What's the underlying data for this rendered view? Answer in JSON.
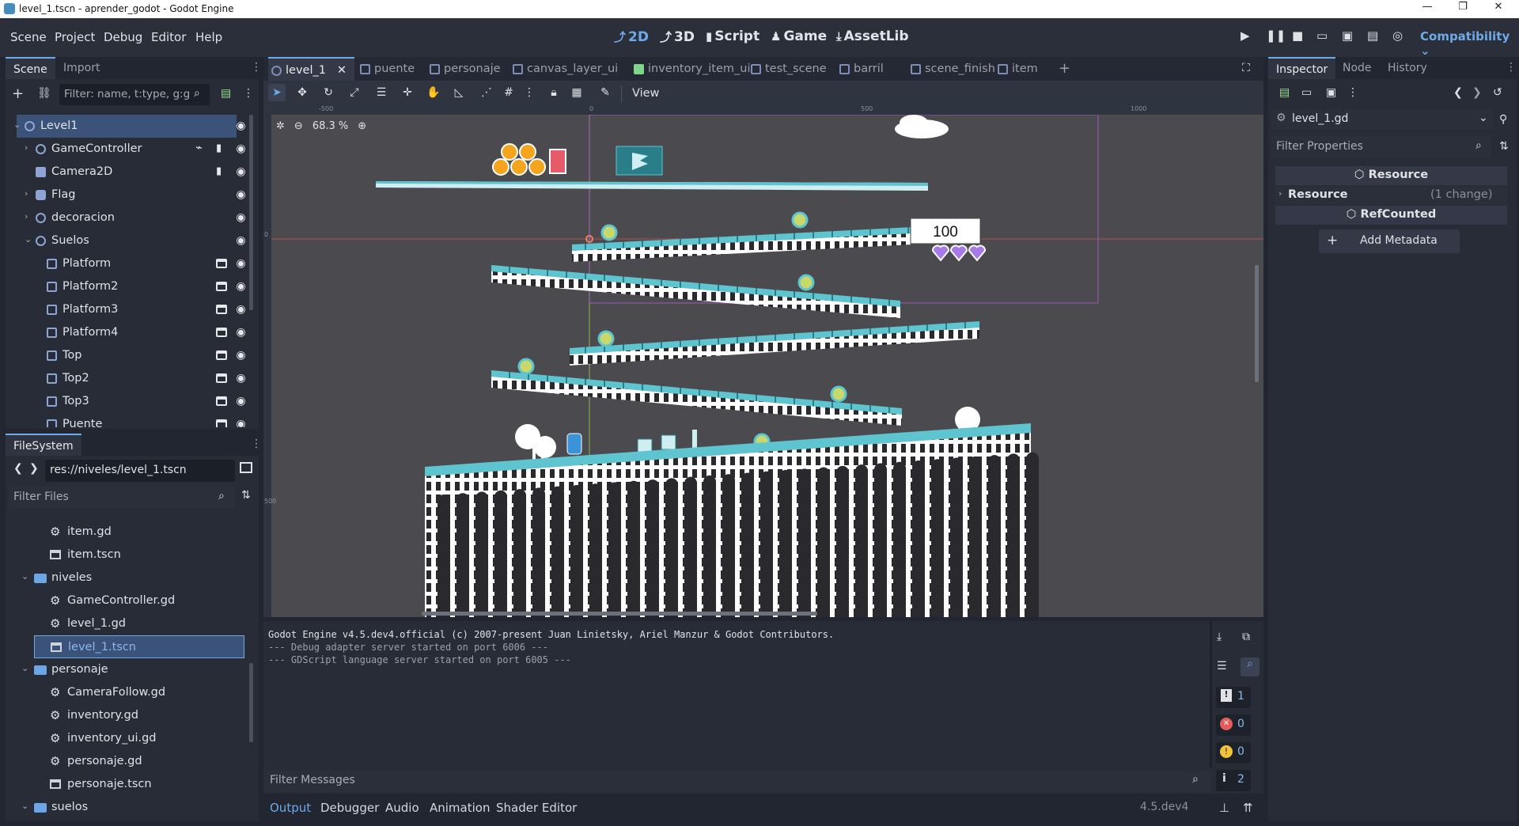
{
  "window": {
    "title": "level_1.tscn - aprender_godot - Godot Engine",
    "controls": [
      "—",
      "❐",
      "✕"
    ]
  },
  "menu": {
    "items": [
      "Scene",
      "Project",
      "Debug",
      "Editor",
      "Help"
    ]
  },
  "workspaces": {
    "items": [
      {
        "label": "2D",
        "glyph": "⤴"
      },
      {
        "label": "3D",
        "glyph": "⤴"
      },
      {
        "label": "Script",
        "glyph": "▮"
      },
      {
        "label": "Game",
        "glyph": "♟"
      },
      {
        "label": "AssetLib",
        "glyph": "⤓"
      }
    ],
    "renderer": "Compatibility"
  },
  "scene_dock": {
    "tabs": [
      "Scene",
      "Import"
    ],
    "filter_placeholder": "Filter: name, t:type, g:g",
    "nodes": [
      {
        "name": "Level1",
        "type": "node2d",
        "depth": 0,
        "expanded": true,
        "selected": true
      },
      {
        "name": "GameController",
        "type": "node2d",
        "depth": 1,
        "expanded": false
      },
      {
        "name": "Camera2D",
        "type": "camera",
        "depth": 1
      },
      {
        "name": "Flag",
        "type": "area",
        "depth": 1,
        "expanded": false
      },
      {
        "name": "decoracion",
        "type": "node2d",
        "depth": 1,
        "expanded": false
      },
      {
        "name": "Suelos",
        "type": "node2d",
        "depth": 1,
        "expanded": true
      },
      {
        "name": "Platform",
        "type": "scene",
        "depth": 2
      },
      {
        "name": "Platform2",
        "type": "scene",
        "depth": 2
      },
      {
        "name": "Platform3",
        "type": "scene",
        "depth": 2
      },
      {
        "name": "Platform4",
        "type": "scene",
        "depth": 2
      },
      {
        "name": "Top",
        "type": "scene",
        "depth": 2
      },
      {
        "name": "Top2",
        "type": "scene",
        "depth": 2
      },
      {
        "name": "Top3",
        "type": "scene",
        "depth": 2
      },
      {
        "name": "Puente",
        "type": "scene",
        "depth": 2
      }
    ]
  },
  "filesystem": {
    "tab": "FileSystem",
    "path": "res://niveles/level_1.tscn",
    "filter_placeholder": "Filter Files",
    "items": [
      {
        "name": "item.gd",
        "kind": "script",
        "depth": 2
      },
      {
        "name": "item.tscn",
        "kind": "scene",
        "depth": 2
      },
      {
        "name": "niveles",
        "kind": "folder",
        "depth": 1
      },
      {
        "name": "GameController.gd",
        "kind": "script",
        "depth": 2
      },
      {
        "name": "level_1.gd",
        "kind": "script",
        "depth": 2
      },
      {
        "name": "level_1.tscn",
        "kind": "scene",
        "depth": 2,
        "selected": true
      },
      {
        "name": "personaje",
        "kind": "folder",
        "depth": 1
      },
      {
        "name": "CameraFollow.gd",
        "kind": "script",
        "depth": 2
      },
      {
        "name": "inventory.gd",
        "kind": "script",
        "depth": 2
      },
      {
        "name": "inventory_ui.gd",
        "kind": "script",
        "depth": 2
      },
      {
        "name": "personaje.gd",
        "kind": "script",
        "depth": 2
      },
      {
        "name": "personaje.tscn",
        "kind": "scene",
        "depth": 2
      },
      {
        "name": "suelos",
        "kind": "folder",
        "depth": 1
      }
    ]
  },
  "editor_tabs": [
    {
      "label": "level_1",
      "selected": true
    },
    {
      "label": "puente"
    },
    {
      "label": "personaje"
    },
    {
      "label": "canvas_layer_ui"
    },
    {
      "label": "inventory_item_ui"
    },
    {
      "label": "test_scene"
    },
    {
      "label": "barril"
    },
    {
      "label": "scene_finish"
    },
    {
      "label": "item"
    }
  ],
  "toolbar": {
    "view_label": "View"
  },
  "viewport": {
    "zoom": "68.3 %",
    "ruler_top": [
      "-500",
      "0",
      "500",
      "1000"
    ],
    "ruler_left": [
      "0",
      "500"
    ],
    "hud_score": "100",
    "hearts": 3
  },
  "output": {
    "lines": [
      "Godot Engine v4.5.dev4.official (c) 2007-present Juan Linietsky, Ariel Manzur & Godot Contributors.",
      "--- Debug adapter server started on port 6006 ---",
      "--- GDScript language server started on port 6005 ---"
    ],
    "filter_placeholder": "Filter Messages",
    "counts": {
      "messages": "1",
      "errors": "0",
      "warnings": "0",
      "info": "2"
    }
  },
  "bottom_tabs": {
    "items": [
      "Output",
      "Debugger",
      "Audio",
      "Animation",
      "Shader Editor"
    ],
    "active": "Output",
    "version": "4.5.dev4"
  },
  "inspector": {
    "tabs": [
      "Inspector",
      "Node",
      "History"
    ],
    "resource_name": "level_1.gd",
    "filter_placeholder": "Filter Properties",
    "section1": "Resource",
    "group": "Resource",
    "group_note": "(1 change)",
    "section2": "RefCounted",
    "add_metadata": "Add Metadata"
  },
  "colors": {
    "accent": "#6fa9e8",
    "selected_row": "#3b5378",
    "viewport_bg": "#4b4b4f",
    "platform": "#5ec4cf",
    "coin": "#f5a51d"
  }
}
